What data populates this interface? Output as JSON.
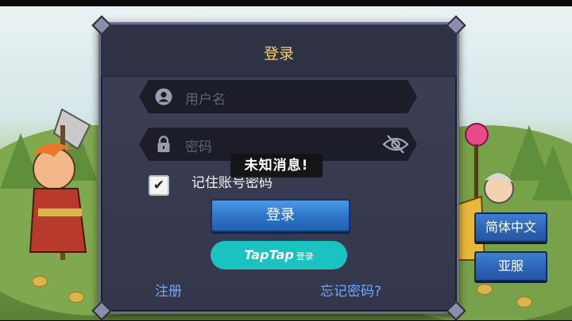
{
  "dialog": {
    "title": "登录"
  },
  "username": {
    "placeholder": "用户名"
  },
  "password": {
    "placeholder": "密码"
  },
  "remember": {
    "label": "记住账号密码",
    "checked": true,
    "check_glyph": "✔"
  },
  "toast": {
    "text": "未知消息!"
  },
  "buttons": {
    "login": "登录",
    "taptap_logo": "TapTap",
    "taptap_suffix": "登录"
  },
  "links": {
    "register": "注册",
    "forgot": "忘记密码?"
  },
  "side": {
    "language": "简体中文",
    "server": "亚服"
  },
  "colors": {
    "title": "#f0d27a",
    "link": "#6ea8ff",
    "login_button": "#2f74c8",
    "taptap_button": "#1bc2c2"
  },
  "icons": [
    "user-icon",
    "lock-icon",
    "eye-slash-icon",
    "checkmark-icon"
  ]
}
